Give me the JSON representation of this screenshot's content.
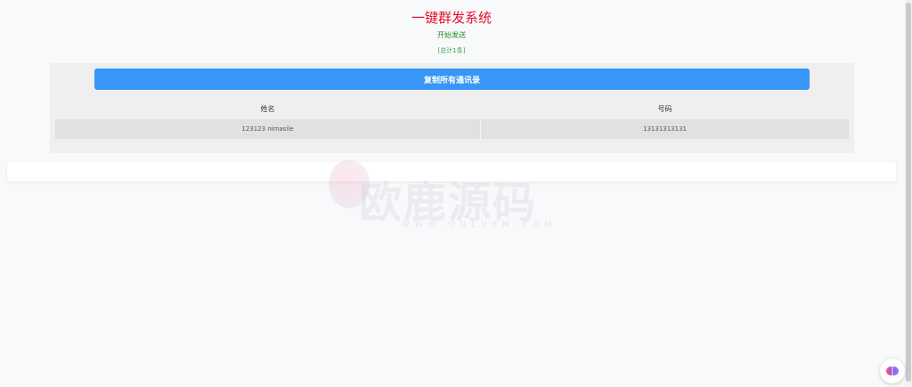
{
  "header": {
    "title": "一键群发系统",
    "start_link": "开始发送",
    "total": "[总计1条]"
  },
  "panel": {
    "copy_button": "复制所有通讯录",
    "columns": [
      "姓名",
      "号码"
    ],
    "rows": [
      {
        "name": "123123 nimasile",
        "phone": "13131313131"
      }
    ]
  },
  "watermark": {
    "text": "欧鹿源码",
    "url": "WWW.OULUYM.COM"
  },
  "colors": {
    "title": "#e8102a",
    "link": "#1e8a2c",
    "button": "#3896f6"
  },
  "icons": {
    "assistant": "assistant-bubble-icon"
  }
}
